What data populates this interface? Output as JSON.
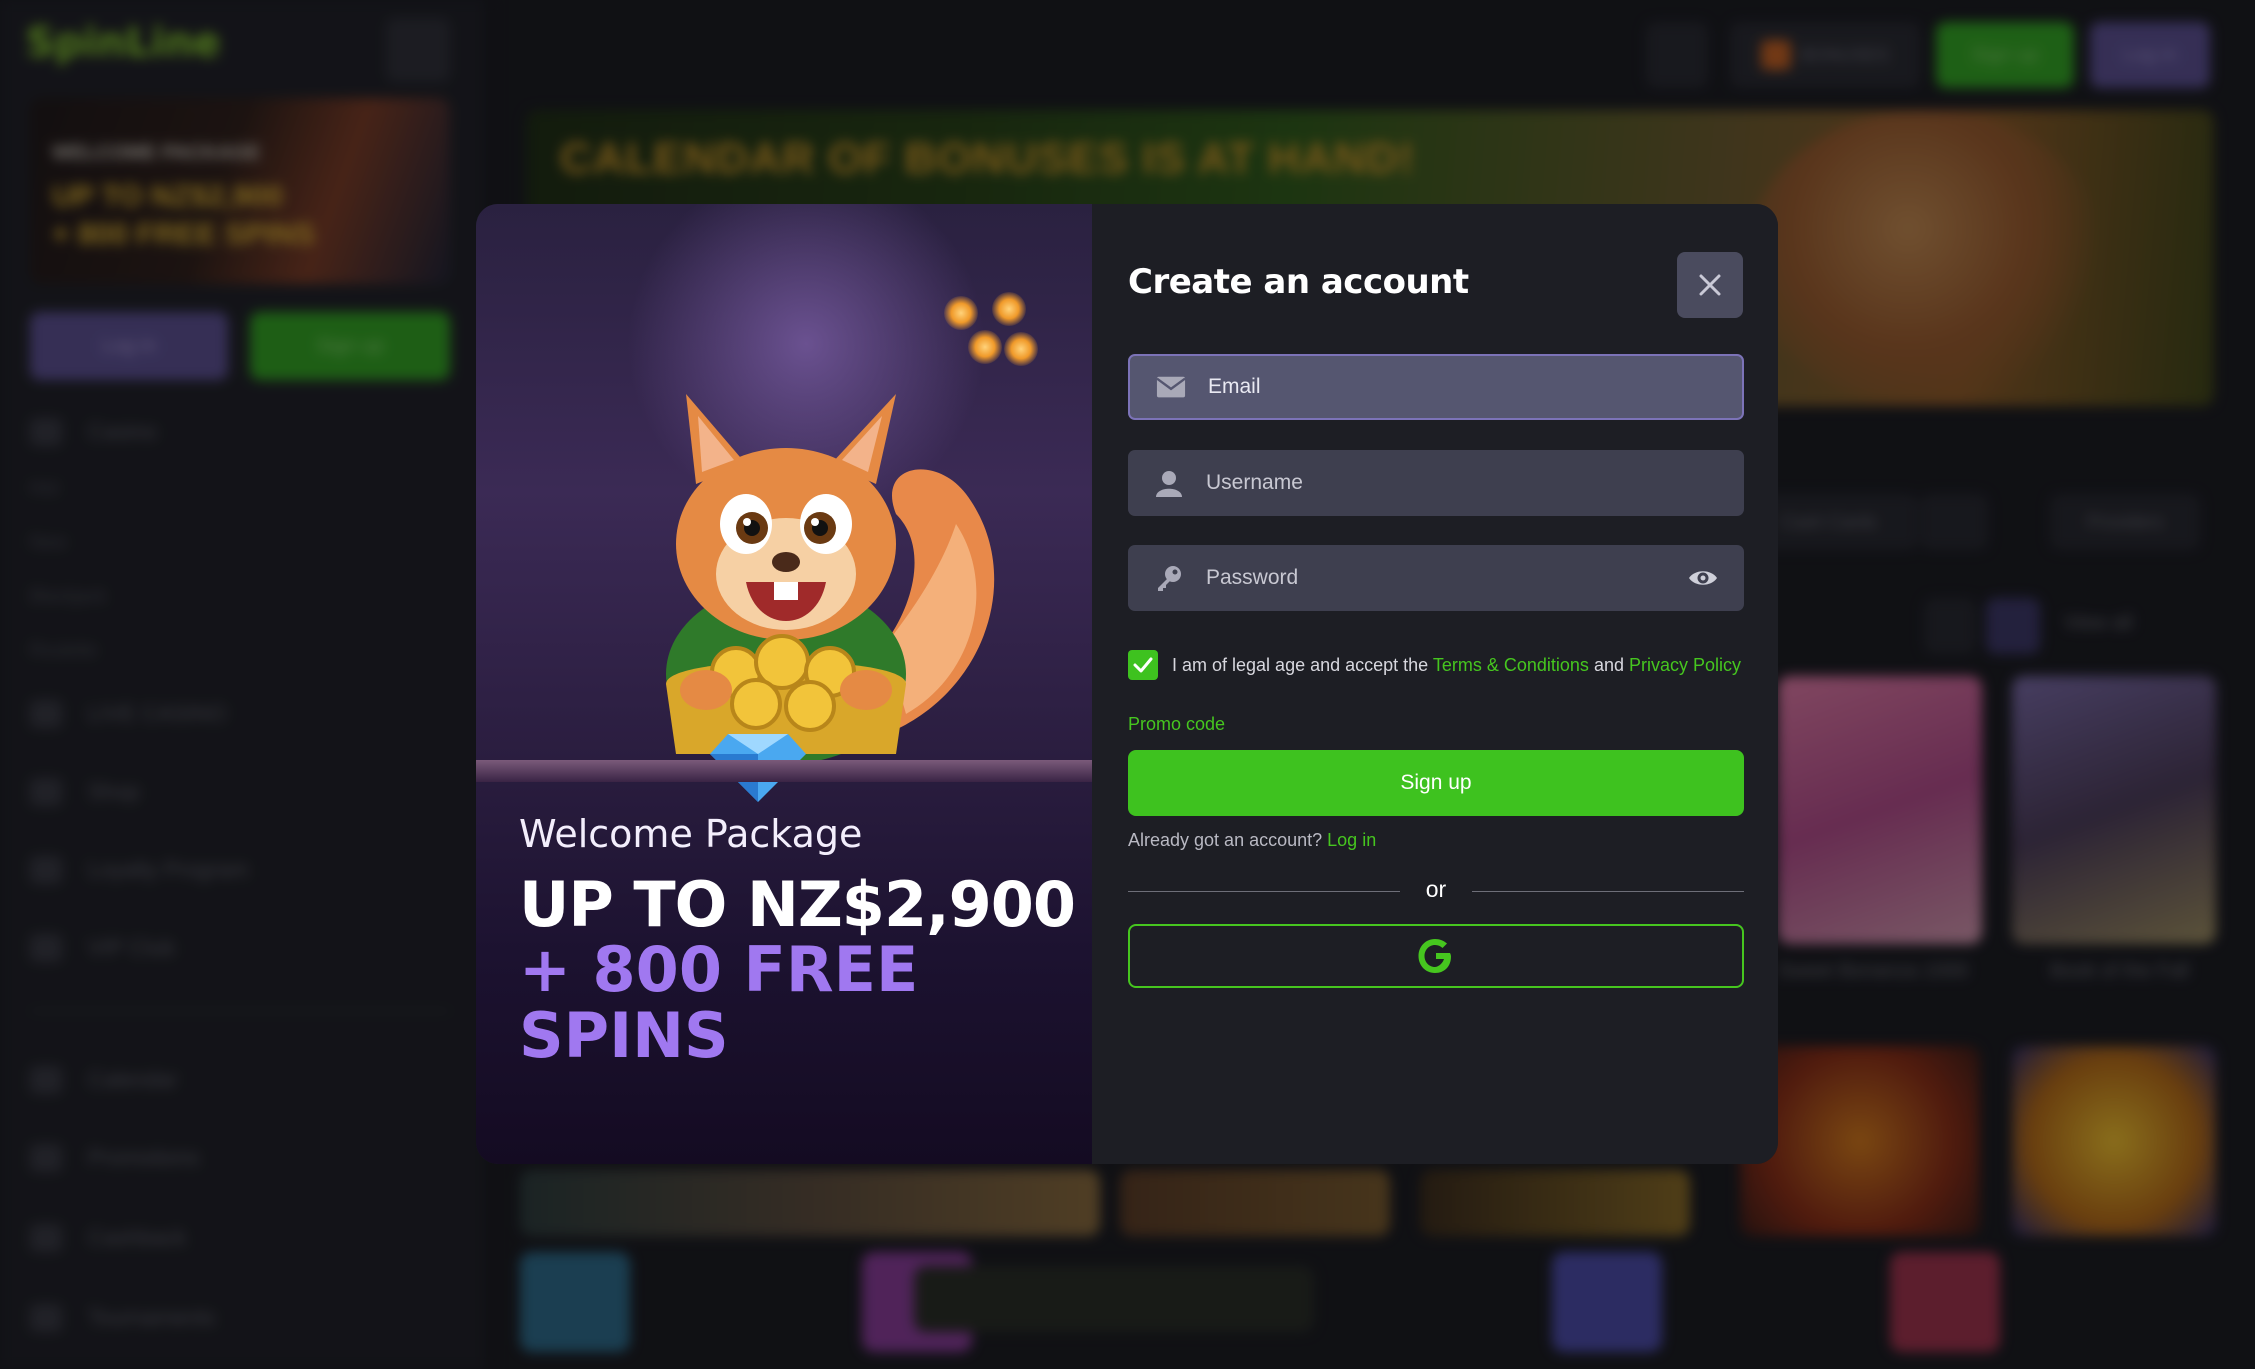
{
  "background": {
    "logo_text": "SpinLine",
    "promo_card": {
      "line1": "WELCOME PACKAGE",
      "line2": "UP TO NZ$2,900",
      "line3": "+ 800 FREE SPINS"
    },
    "sidebar_login": "Log in",
    "sidebar_signup": "Sign up",
    "nav": [
      "Casino",
      "Hot",
      "New",
      "Blackjack",
      "Roulette",
      "LIVE CASINO",
      "Shop",
      "Loyalty Program",
      "VIP Club",
      "Calendar",
      "Promotions",
      "Cashback",
      "Tournaments"
    ],
    "topbar": {
      "bonuses": "BONUSES",
      "signup": "Sign up",
      "login": "Log in"
    },
    "banner_title": "CALENDAR OF BONUSES IS AT HAND!",
    "chips": {
      "cards": "Cash Cards",
      "providers": "Providers"
    },
    "view_all": "View all",
    "games": [
      "Sweet Bonanza 1000",
      "Book of the Fall"
    ]
  },
  "modal": {
    "welcome_sub": "Welcome Package",
    "welcome_main": "UP TO NZ$2,900",
    "welcome_accent": "+ 800 FREE SPINS",
    "title": "Create an account",
    "email_placeholder": "Email",
    "username_placeholder": "Username",
    "password_placeholder": "Password",
    "terms_prefix": "I am of legal age and accept the",
    "terms_link": "Terms & Conditions",
    "terms_and": "and",
    "privacy_link": "Privacy Policy",
    "terms_checked": true,
    "promo_code": "Promo code",
    "signup_label": "Sign up",
    "already_text": "Already got an account?",
    "login_link": "Log in",
    "or_text": "or",
    "google_letter": "G"
  },
  "colors": {
    "accent_green": "#3ec21f",
    "accent_purple": "#a078f0",
    "modal_bg": "#1d1e24",
    "field_bg": "#3e3f4f"
  }
}
